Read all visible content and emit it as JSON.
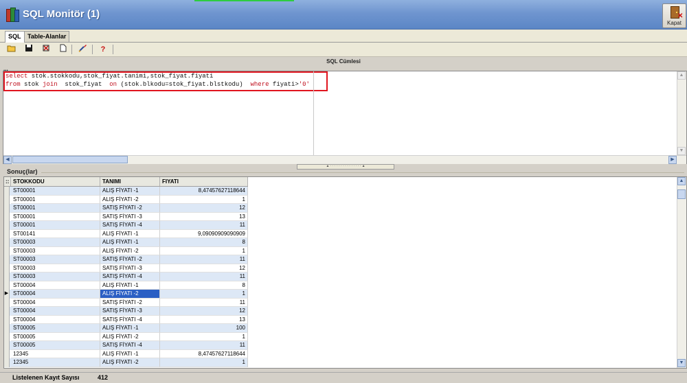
{
  "window": {
    "title": "SQL Monitör (1)",
    "close_label": "Kapat"
  },
  "tabs": [
    {
      "label": "SQL",
      "active": true
    },
    {
      "label": "Table-Alanlar",
      "active": false
    }
  ],
  "toolbar": {
    "icons": [
      "open-folder-icon",
      "save-icon",
      "clear-icon",
      "new-document-icon",
      "execute-icon",
      "help-icon"
    ],
    "help_glyph": "?"
  },
  "editor": {
    "header": "SQL Cümlesi",
    "marker": "...",
    "line1": {
      "kw": "select",
      "rest": " stok.stokkodu,stok_fiyat.tanimi,stok_fiyat.fiyati"
    },
    "line2": {
      "kw_from": "from",
      "t1": " stok ",
      "kw_join": "join",
      "t2": "  stok_fiyat  ",
      "kw_on": "on",
      "t3": " (stok.blkodu=stok_fiyat.blstkodu)  ",
      "kw_where": "where",
      "t4": " fiyati>",
      "str": "'0'"
    }
  },
  "results": {
    "label": "Sonuç(lar)",
    "corner": "::",
    "columns": [
      "STOKKODU",
      "TANIMI",
      "FIYATI"
    ],
    "selected_row": 12,
    "rows": [
      [
        "ST00001",
        "ALIŞ FİYATI -1",
        "8,47457627118644"
      ],
      [
        "ST00001",
        "ALIŞ FİYATI -2",
        "1"
      ],
      [
        "ST00001",
        "SATIŞ FİYATI -2",
        "12"
      ],
      [
        "ST00001",
        "SATIŞ FİYATI -3",
        "13"
      ],
      [
        "ST00001",
        "SATIŞ FİYATI -4",
        "11"
      ],
      [
        "ST00141",
        "ALIŞ FİYATI -1",
        "9,09090909090909"
      ],
      [
        "ST00003",
        "ALIŞ FİYATI -1",
        "8"
      ],
      [
        "ST00003",
        "ALIŞ FİYATI -2",
        "1"
      ],
      [
        "ST00003",
        "SATIŞ FİYATI -2",
        "11"
      ],
      [
        "ST00003",
        "SATIŞ FİYATI -3",
        "12"
      ],
      [
        "ST00003",
        "SATIŞ FİYATI -4",
        "11"
      ],
      [
        "ST00004",
        "ALIŞ FİYATI -1",
        "8"
      ],
      [
        "ST00004",
        "ALIŞ FİYATI -2",
        "1"
      ],
      [
        "ST00004",
        "SATIŞ FİYATI -2",
        "11"
      ],
      [
        "ST00004",
        "SATIŞ FİYATI -3",
        "12"
      ],
      [
        "ST00004",
        "SATIŞ FİYATI -4",
        "13"
      ],
      [
        "ST00005",
        "ALIŞ FİYATI -1",
        "100"
      ],
      [
        "ST00005",
        "ALIŞ FİYATI -2",
        "1"
      ],
      [
        "ST00005",
        "SATIŞ FİYATI -4",
        "11"
      ],
      [
        "12345",
        "ALIŞ FİYATI -1",
        "8,47457627118644"
      ],
      [
        "12345",
        "ALIŞ FİYATI -2",
        "1"
      ]
    ]
  },
  "status": {
    "label": "Listelenen Kayıt Sayısı",
    "count": "412"
  },
  "colors": {
    "title_bar": "#6f95cf",
    "row_alt": "#dde8f6",
    "selection": "#2b5fc4",
    "highlight_box": "#e0141e"
  }
}
